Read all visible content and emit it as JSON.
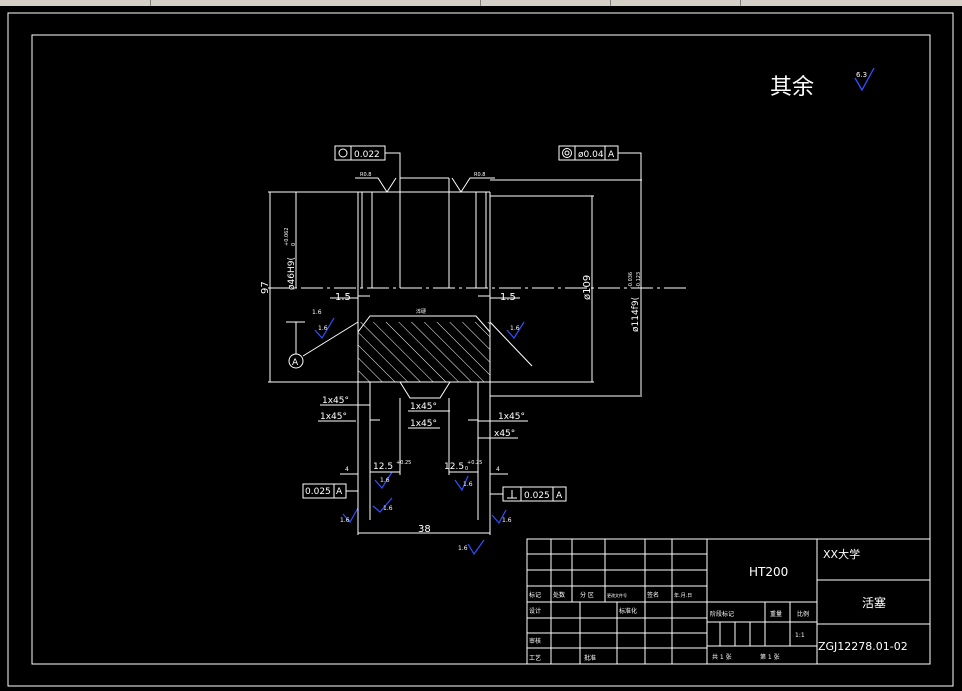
{
  "surface_finish": {
    "label": "其余",
    "value": "6.3"
  },
  "tolerance_frames": {
    "circularity": {
      "value": "0.022"
    },
    "coaxiality": {
      "value": "ø0.04",
      "datum": "A"
    },
    "left": {
      "value": "0.025",
      "datum": "A"
    },
    "right": {
      "value": "0.025",
      "datum": "A"
    }
  },
  "roughness_callouts": [
    "R0.8",
    "R0.8",
    "1.6",
    "1.6",
    "1.6",
    "1.6",
    "1.6",
    "1.6",
    "1.6",
    "1.6",
    "1.6",
    "1.6",
    "1.6"
  ],
  "dimensions": {
    "height": "97",
    "bore": "ø46H9(",
    "bore_tol": "+0.062",
    "bore_tol_low": "0",
    "mid_dia": "ø109",
    "outer_dia": "ø114f9(",
    "outer_tol": "-0.036",
    "outer_tol_low": "-0.123",
    "left_step": "1.5",
    "right_step": "1.5",
    "chamfers": [
      "1x45°",
      "1x45°",
      "1x45°",
      "1x45°",
      "1x45°",
      "x45°"
    ],
    "groove_left": "12.5",
    "groove_left_tol": "+0.25",
    "groove_right": "12.5",
    "groove_right_tol": "+0.25",
    "groove_right_tol_low": "0",
    "small_left": "4",
    "small_right": "4",
    "width": "38",
    "hatch_note": "淬硬"
  },
  "datum": "A",
  "title_block": {
    "material": "HT200",
    "school": "XX大学",
    "part_name": "活塞",
    "drawing_no": "ZGJ12278.01-02",
    "scale": "1:1",
    "labels": {
      "mark": "标记",
      "count": "处数",
      "zone": "分 区",
      "doc": "更改文件号",
      "sign": "签名",
      "date": "年.月.日",
      "design": "设计",
      "standard": "标准化",
      "stage": "阶段标记",
      "weight": "重量",
      "ratio": "比例",
      "review": "审核",
      "process": "工艺",
      "approve": "批准",
      "total": "共 1 张",
      "sheet": "第 1 张"
    }
  }
}
